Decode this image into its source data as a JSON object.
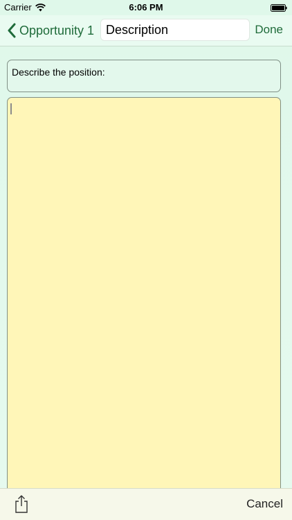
{
  "status_bar": {
    "carrier": "Carrier",
    "time": "6:06 PM"
  },
  "nav_bar": {
    "back_label": "Opportunity 1",
    "title_value": "Description",
    "done_label": "Done"
  },
  "prompt": {
    "label": "Describe the position:"
  },
  "editor": {
    "value": ""
  },
  "toolbar": {
    "cancel_label": "Cancel"
  },
  "icons": {
    "wifi": "wifi-icon",
    "battery": "battery-icon",
    "back": "chevron-left-icon",
    "share": "share-icon"
  },
  "colors": {
    "accent": "#1f6b3a",
    "background": "#e3f8ec",
    "editor_background": "#fff6b8",
    "toolbar_background": "#f6f8ea"
  }
}
